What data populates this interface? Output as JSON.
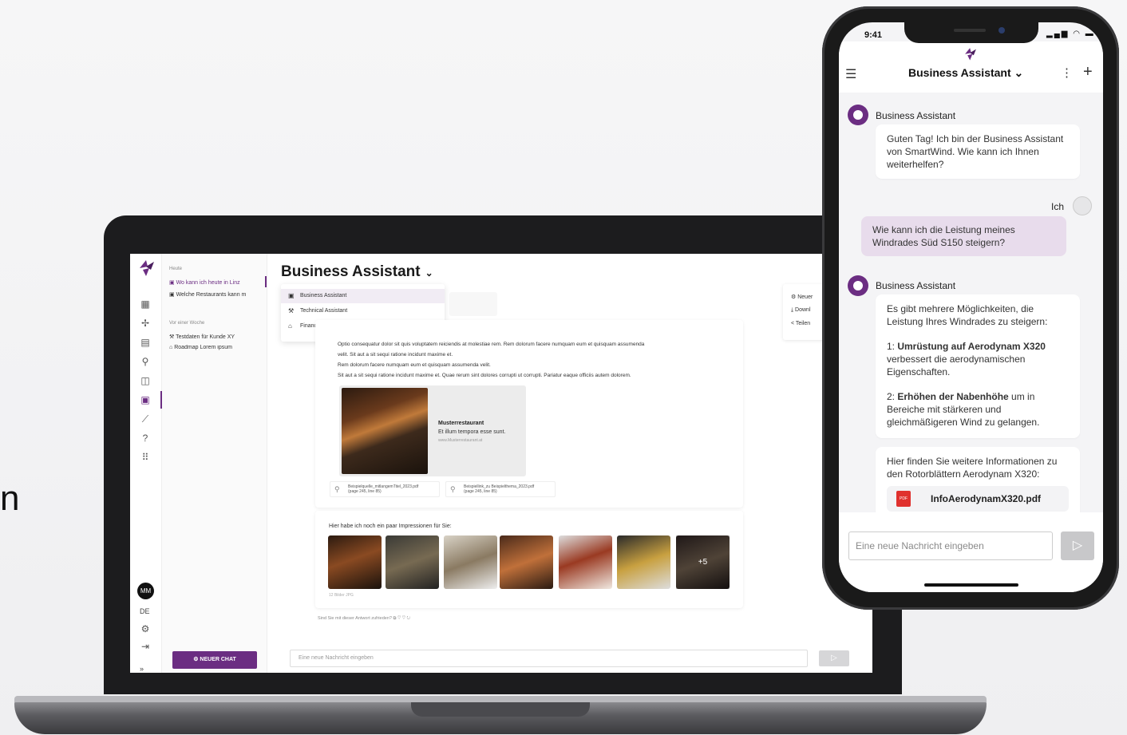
{
  "edge_glyph": "n",
  "laptop": {
    "history": {
      "today_label": "Heute",
      "today_items": [
        "Wo kann ich heute in Linz",
        "Welche Restaurants kann m"
      ],
      "week_label": "Vor einer Woche",
      "week_items": [
        "Testdaten für Kunde XY",
        "Roadmap Lorem ipsum"
      ]
    },
    "rail": {
      "avatar": "MM",
      "lang": "DE",
      "expand": "»"
    },
    "new_chat_label": "NEUER CHAT",
    "title": "Business Assistant",
    "assistants": [
      "Business Assistant",
      "Technical Assistant",
      "Finance Assistant"
    ],
    "side_menu": [
      "Neuer",
      "Downl",
      "Teilen"
    ],
    "paragraph_lines": [
      "Optio consequatur dolor sit quis voluptatem reiciendis at molestiae rem. Rem dolorum facere numquam eum et quisquam assumenda",
      "velit. Sit aut a sit sequi ratione incidunt maxime et.",
      "Rem dolorum facere numquam eum et quisquam assumenda velit.",
      "Sit aut a sit sequi ratione incidunt maxime et. Quae rerum sint dolores corrupti ut corrupti. Pariatur eaque officiis autem dolorem."
    ],
    "restaurant": {
      "title": "Musterrestaurant",
      "subtitle": "Et illum tempora esse sunt.",
      "url": "www.Musterrestaurant.at"
    },
    "sources": [
      {
        "name": "Beispielquelle_mitlangemTitel_2023.pdf",
        "page": "(page 245, line 85)"
      },
      {
        "name": "Beispiellink_zu Beispielthema_2023.pdf",
        "page": "(page 245, line 85)"
      }
    ],
    "impressions_caption": "Hier habe ich noch ein paar Impressionen für Sie:",
    "more_count": "+5",
    "images_meta": "12 Bilder JPG",
    "feedback_question": "Sind Sie mit dieser Antwort zufrieden?",
    "input_placeholder": "Eine neue Nachricht eingeben"
  },
  "phone": {
    "time": "9:41",
    "title": "Business Assistant",
    "bot_name": "Business Assistant",
    "greeting": "Guten Tag! Ich bin der Business Assistant von SmartWind. Wie kann ich Ihnen weiterhelfen?",
    "user_label": "Ich",
    "user_message": "Wie kann ich die Leistung meines Windrades Süd S150 steigern?",
    "answer_intro": "Es gibt mehrere Möglichkeiten, die Leistung Ihres Windrades zu steigern:",
    "option1_prefix": "1: ",
    "option1_bold": "Umrüstung auf Aerodynam X320",
    "option1_rest": " verbessert die aerodynamischen Eigenschaften.",
    "option2_prefix": "2: ",
    "option2_bold": "Erhöhen der Nabenhöhe",
    "option2_rest": " um in Bereiche mit stärkeren und gleichmäßigeren Wind zu gelangen.",
    "info_text": "Hier finden Sie weitere Informationen zu den Rotorblättern Aerodynam X320:",
    "pdf_icon_label": "PDF",
    "pdf_name": "InfoAerodynamX320.pdf",
    "input_placeholder": "Eine neue Nachricht eingeben"
  },
  "colors": {
    "brand": "#6b2d82",
    "user_bubble": "#e8dcec"
  }
}
